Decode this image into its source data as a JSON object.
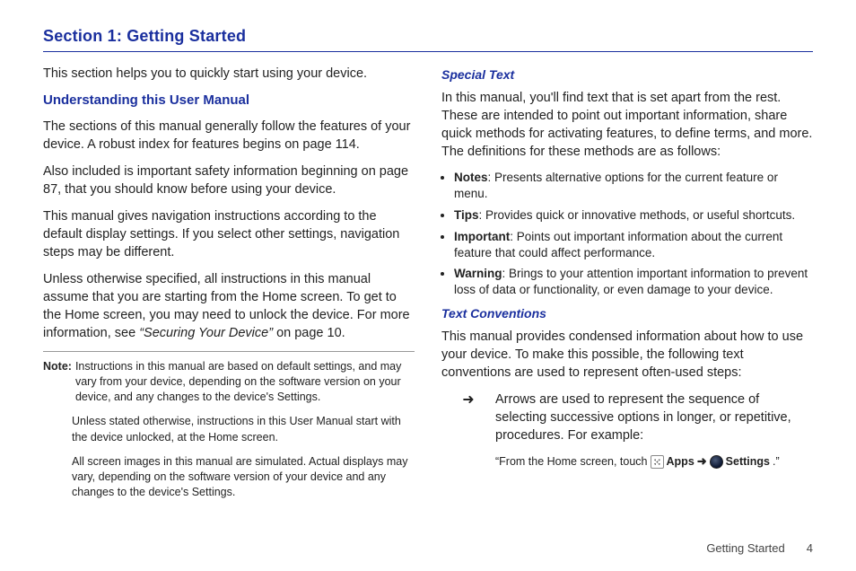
{
  "section_title": "Section 1: Getting Started",
  "left": {
    "intro": "This section helps you to quickly start using your device.",
    "h2": "Understanding this User Manual",
    "p1": "The sections of this manual generally follow the features of your device. A robust index for features begins on page 114.",
    "p2": "Also included is important safety information beginning on page 87, that you should know before using your device.",
    "p3": "This manual gives navigation instructions according to the default display settings. If you select other settings, navigation steps may be different.",
    "p4a": "Unless otherwise specified, all instructions in this manual assume that you are starting from the Home screen. To get to the Home screen, you may need to unlock the device. For more information, see ",
    "p4_xref": "“Securing Your Device”",
    "p4b": " on page 10.",
    "note_label": "Note:",
    "note1": "Instructions in this manual are based on default settings, and may vary from your device, depending on the software version on your device, and any changes to the device's Settings.",
    "note2": "Unless stated otherwise, instructions in this User Manual start with the device unlocked, at the Home screen.",
    "note3": "All screen images in this manual are simulated. Actual displays may vary, depending on the software version of your device and any changes to the device's Settings."
  },
  "right": {
    "h3a": "Special Text",
    "p1": "In this manual, you'll find text that is set apart from the rest. These are intended to point out important information, share quick methods for activating features, to define terms, and more. The definitions for these methods are as follows:",
    "bullets": {
      "notes_label": "Notes",
      "notes_text": ": Presents alternative options for the current feature or menu.",
      "tips_label": "Tips",
      "tips_text": ": Provides quick or innovative methods, or useful shortcuts.",
      "important_label": "Important",
      "important_text": ": Points out important information about the current feature that could affect performance.",
      "warning_label": "Warning",
      "warning_text": ": Brings to your attention important information to prevent loss of data or functionality, or even damage to your device."
    },
    "h3b": "Text Conventions",
    "p2": "This manual provides condensed information about how to use your device. To make this possible, the following text conventions are used to represent often-used steps:",
    "arrow_symbol": "➜",
    "arrow_text": "Arrows are used to represent the sequence of selecting successive options in longer, or repetitive, procedures. For example:",
    "example": {
      "open_quote": "“From the Home screen, touch ",
      "apps_label": "Apps",
      "arrow": "➜",
      "settings_label": "Settings",
      "close": ".”"
    }
  },
  "footer": {
    "text": "Getting Started",
    "page": "4"
  }
}
